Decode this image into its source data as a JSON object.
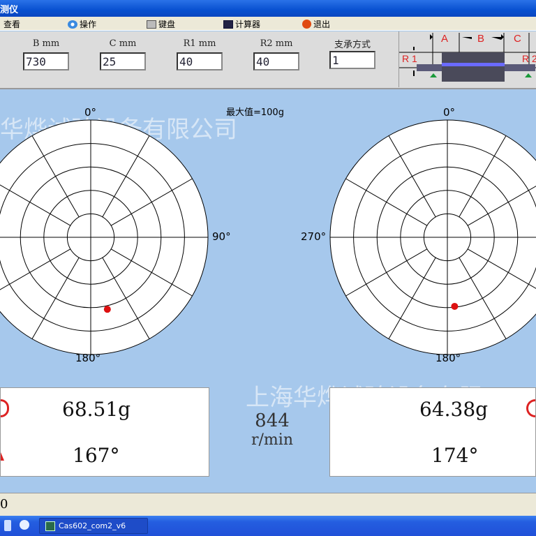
{
  "window": {
    "title": "测仪"
  },
  "menu": [
    {
      "label": "查看"
    },
    {
      "label": "操作",
      "icon": "gear-icon"
    },
    {
      "label": "键盘",
      "icon": "keyboard-icon"
    },
    {
      "label": "计算器",
      "icon": "calculator-icon"
    },
    {
      "label": "退出",
      "icon": "exit-icon"
    }
  ],
  "params": [
    {
      "label": "B  mm",
      "value": "730"
    },
    {
      "label": "C  mm",
      "value": "25"
    },
    {
      "label": "R1  mm",
      "value": "40"
    },
    {
      "label": "R2  mm",
      "value": "40"
    },
    {
      "label": "支承方式",
      "value": "1"
    }
  ],
  "diagram": {
    "a": "A",
    "b": "B",
    "c": "C",
    "r1": "R 1",
    "r2": "R 2"
  },
  "watermark": {
    "top": "华烨试验设备有限公司",
    "bottom": "上海华烨试验设备有限"
  },
  "max_value": "最大值=100g",
  "left_plot": {
    "top": "0°",
    "right": "90°",
    "bottom": "180°",
    "point": {
      "angle_deg": 167,
      "magnitude_g": 68.51
    }
  },
  "right_plot": {
    "top": "0°",
    "left": "270°",
    "bottom": "180°",
    "point": {
      "angle_deg": 174,
      "magnitude_g": 64.38
    }
  },
  "left_result": {
    "mass": "68.51g",
    "angle": "167°"
  },
  "right_result": {
    "mass": "64.38g",
    "angle": "174°"
  },
  "speed": {
    "value": "844",
    "unit": "r/min"
  },
  "status": {
    "text": "0"
  },
  "taskbar": {
    "task": "Cas602_com2_v6"
  },
  "colors": {
    "point": "#dd1111",
    "accent": "#dd2222"
  }
}
